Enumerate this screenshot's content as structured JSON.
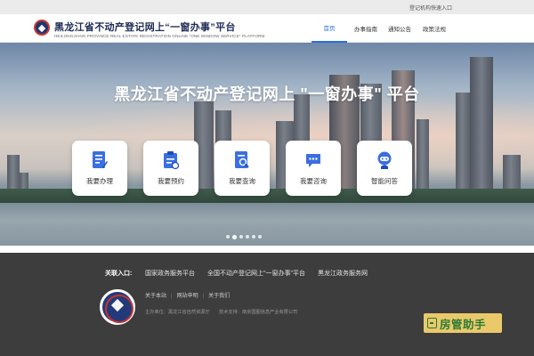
{
  "topbar": {
    "quick_entry": "登记机构快速入口"
  },
  "header": {
    "title": "黑龙江省不动产登记网上“一窗办事”平台",
    "subtitle": "HEILONGJIANG PROVINCE REAL ESTATE REGISTRATION ONLINE \"ONE WINDOW SERVICE\" PLATFORM",
    "nav": [
      {
        "label": "首页",
        "active": true
      },
      {
        "label": "办事指南",
        "active": false
      },
      {
        "label": "通知公告",
        "active": false
      },
      {
        "label": "政策法规",
        "active": false
      }
    ]
  },
  "banner": {
    "title": "黑龙江省不动产登记网上 \"一窗办事\" 平台",
    "cards": [
      {
        "label": "我要办理",
        "icon": "document-edit-icon"
      },
      {
        "label": "我要预约",
        "icon": "calendar-clipboard-icon"
      },
      {
        "label": "我要查询",
        "icon": "document-search-icon"
      },
      {
        "label": "我要咨询",
        "icon": "chat-bubble-icon"
      },
      {
        "label": "智能问答",
        "icon": "robot-icon"
      }
    ],
    "slide_count": 6,
    "active_slide": 1
  },
  "footer": {
    "links_title": "关联入口:",
    "links": [
      "国家政务服务平台",
      "全国不动产登记网上\"一窗办事\"平台",
      "黑龙江政务服务网"
    ],
    "bottom_links": [
      "关于本站",
      "网站申明",
      "关于我们"
    ],
    "meta": "主办单位：黑龙江省自然资源厅　　技术支持：南京国图信息产业有限公司",
    "badge_text": "房管助手"
  },
  "colors": {
    "accent": "#2b6fd6",
    "footer_bg": "#3d3d3d",
    "icon_blue": "#3a6fe0",
    "badge_bg": "#e9c96a",
    "badge_fg": "#2b7a36"
  }
}
